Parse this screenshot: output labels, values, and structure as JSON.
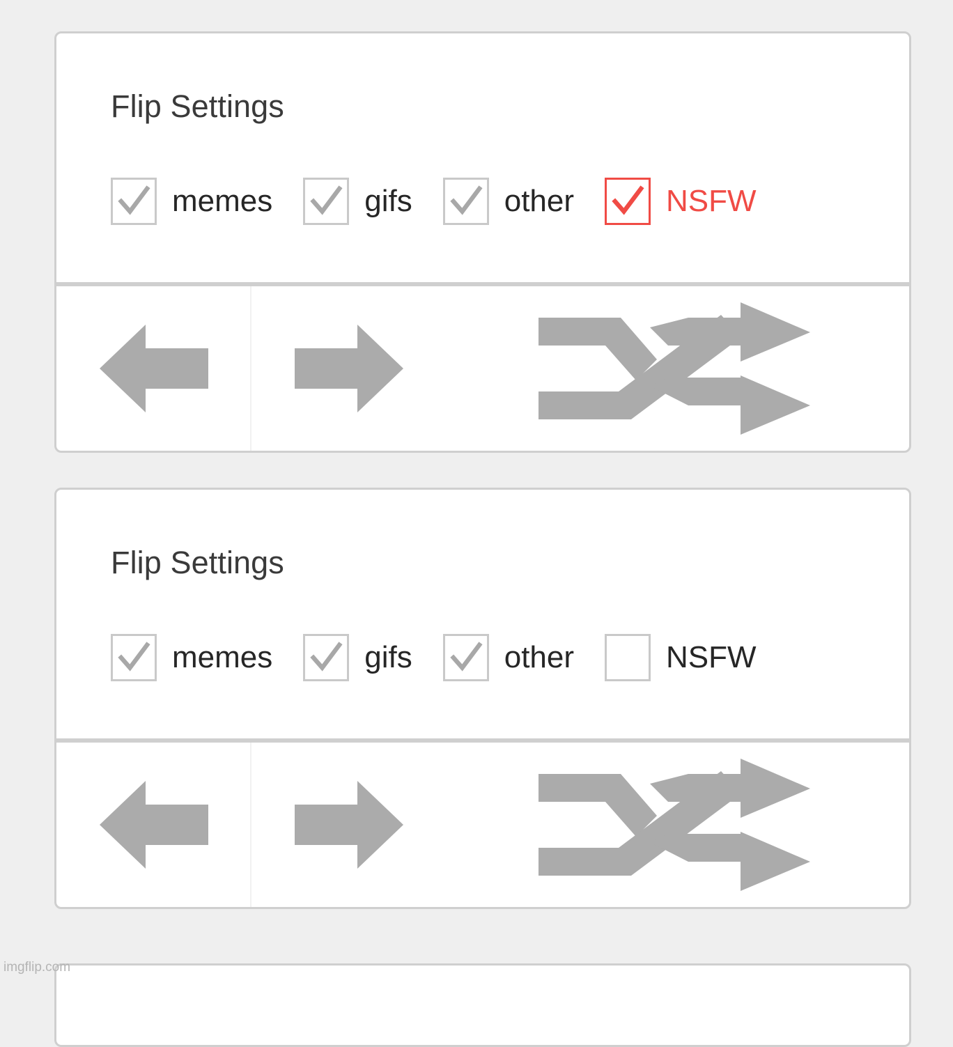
{
  "background_color": "#efefef",
  "panel_border_color": "#cfcfcf",
  "accent_red": "#f04b45",
  "icon_gray": "#ababab",
  "checkbox_gray": "#c9c9c9",
  "text_color": "#262626",
  "title_color": "#3a3a3a",
  "watermark": {
    "text": "imgflip.com"
  },
  "panels": [
    {
      "title": "Flip Settings",
      "checkboxes": [
        {
          "label": "memes",
          "checked": true,
          "highlighted": false
        },
        {
          "label": "gifs",
          "checked": true,
          "highlighted": false
        },
        {
          "label": "other",
          "checked": true,
          "highlighted": false
        },
        {
          "label": "NSFW",
          "checked": true,
          "highlighted": true
        }
      ],
      "buttons": [
        {
          "label": "",
          "icon": "arrow-left-icon"
        },
        {
          "label": "",
          "icon": "arrow-right-icon"
        },
        {
          "label": "",
          "icon": "shuffle-icon"
        }
      ]
    },
    {
      "title": "Flip Settings",
      "checkboxes": [
        {
          "label": "memes",
          "checked": true,
          "highlighted": false
        },
        {
          "label": "gifs",
          "checked": true,
          "highlighted": false
        },
        {
          "label": "other",
          "checked": true,
          "highlighted": false
        },
        {
          "label": "NSFW",
          "checked": false,
          "highlighted": false
        }
      ],
      "buttons": [
        {
          "label": "",
          "icon": "arrow-left-icon"
        },
        {
          "label": "",
          "icon": "arrow-right-icon"
        },
        {
          "label": "",
          "icon": "shuffle-icon"
        }
      ]
    }
  ]
}
